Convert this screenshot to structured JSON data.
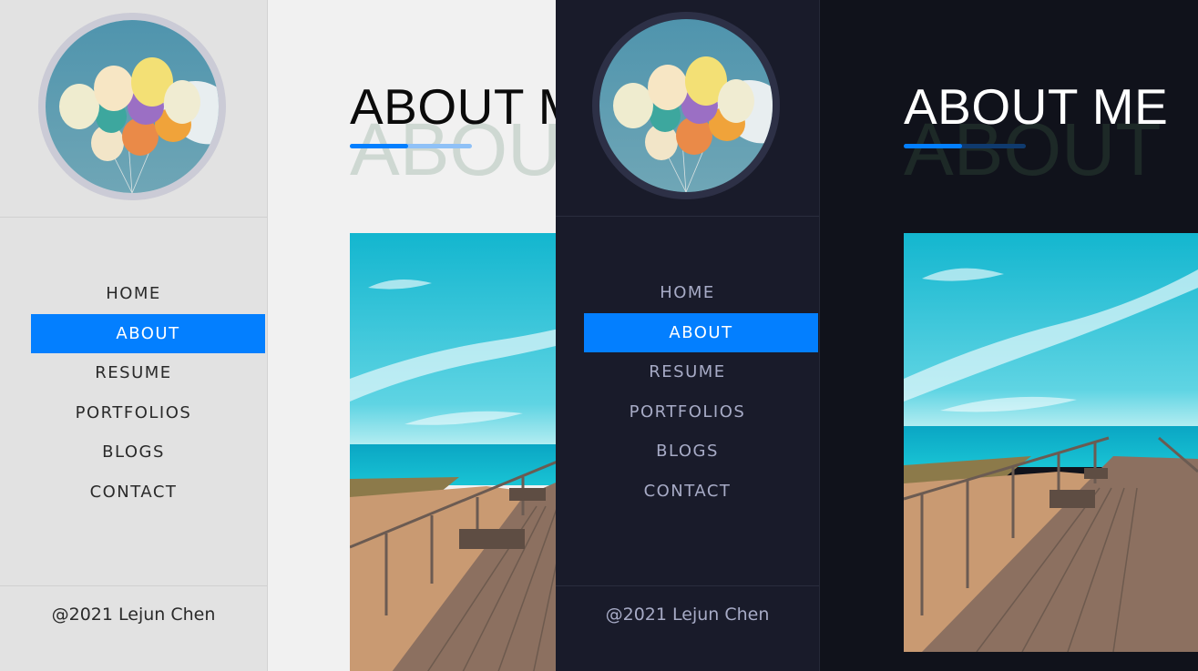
{
  "light": {
    "nav": [
      "HOME",
      "ABOUT",
      "RESUME",
      "PORTFOLIOS",
      "BLOGS",
      "CONTACT"
    ],
    "active_item": "ABOUT",
    "footer": "@2021 Lejun Chen",
    "title": "ABOUT ME",
    "ghost_title": "ABOUT"
  },
  "dark": {
    "nav": [
      "HOME",
      "ABOUT",
      "RESUME",
      "PORTFOLIOS",
      "BLOGS",
      "CONTACT"
    ],
    "active_item": "ABOUT",
    "footer": "@2021 Lejun Chen",
    "title": "ABOUT ME",
    "ghost_title": "ABOUT"
  },
  "colors": {
    "accent": "#037fff",
    "light_sidebar": "#e2e2e2",
    "light_main": "#f1f1f1",
    "dark_sidebar": "#191b2a",
    "dark_main": "#10121b"
  },
  "icons": {
    "avatar": "balloons-avatar",
    "content_image": "seaside-boardwalk-photo"
  }
}
